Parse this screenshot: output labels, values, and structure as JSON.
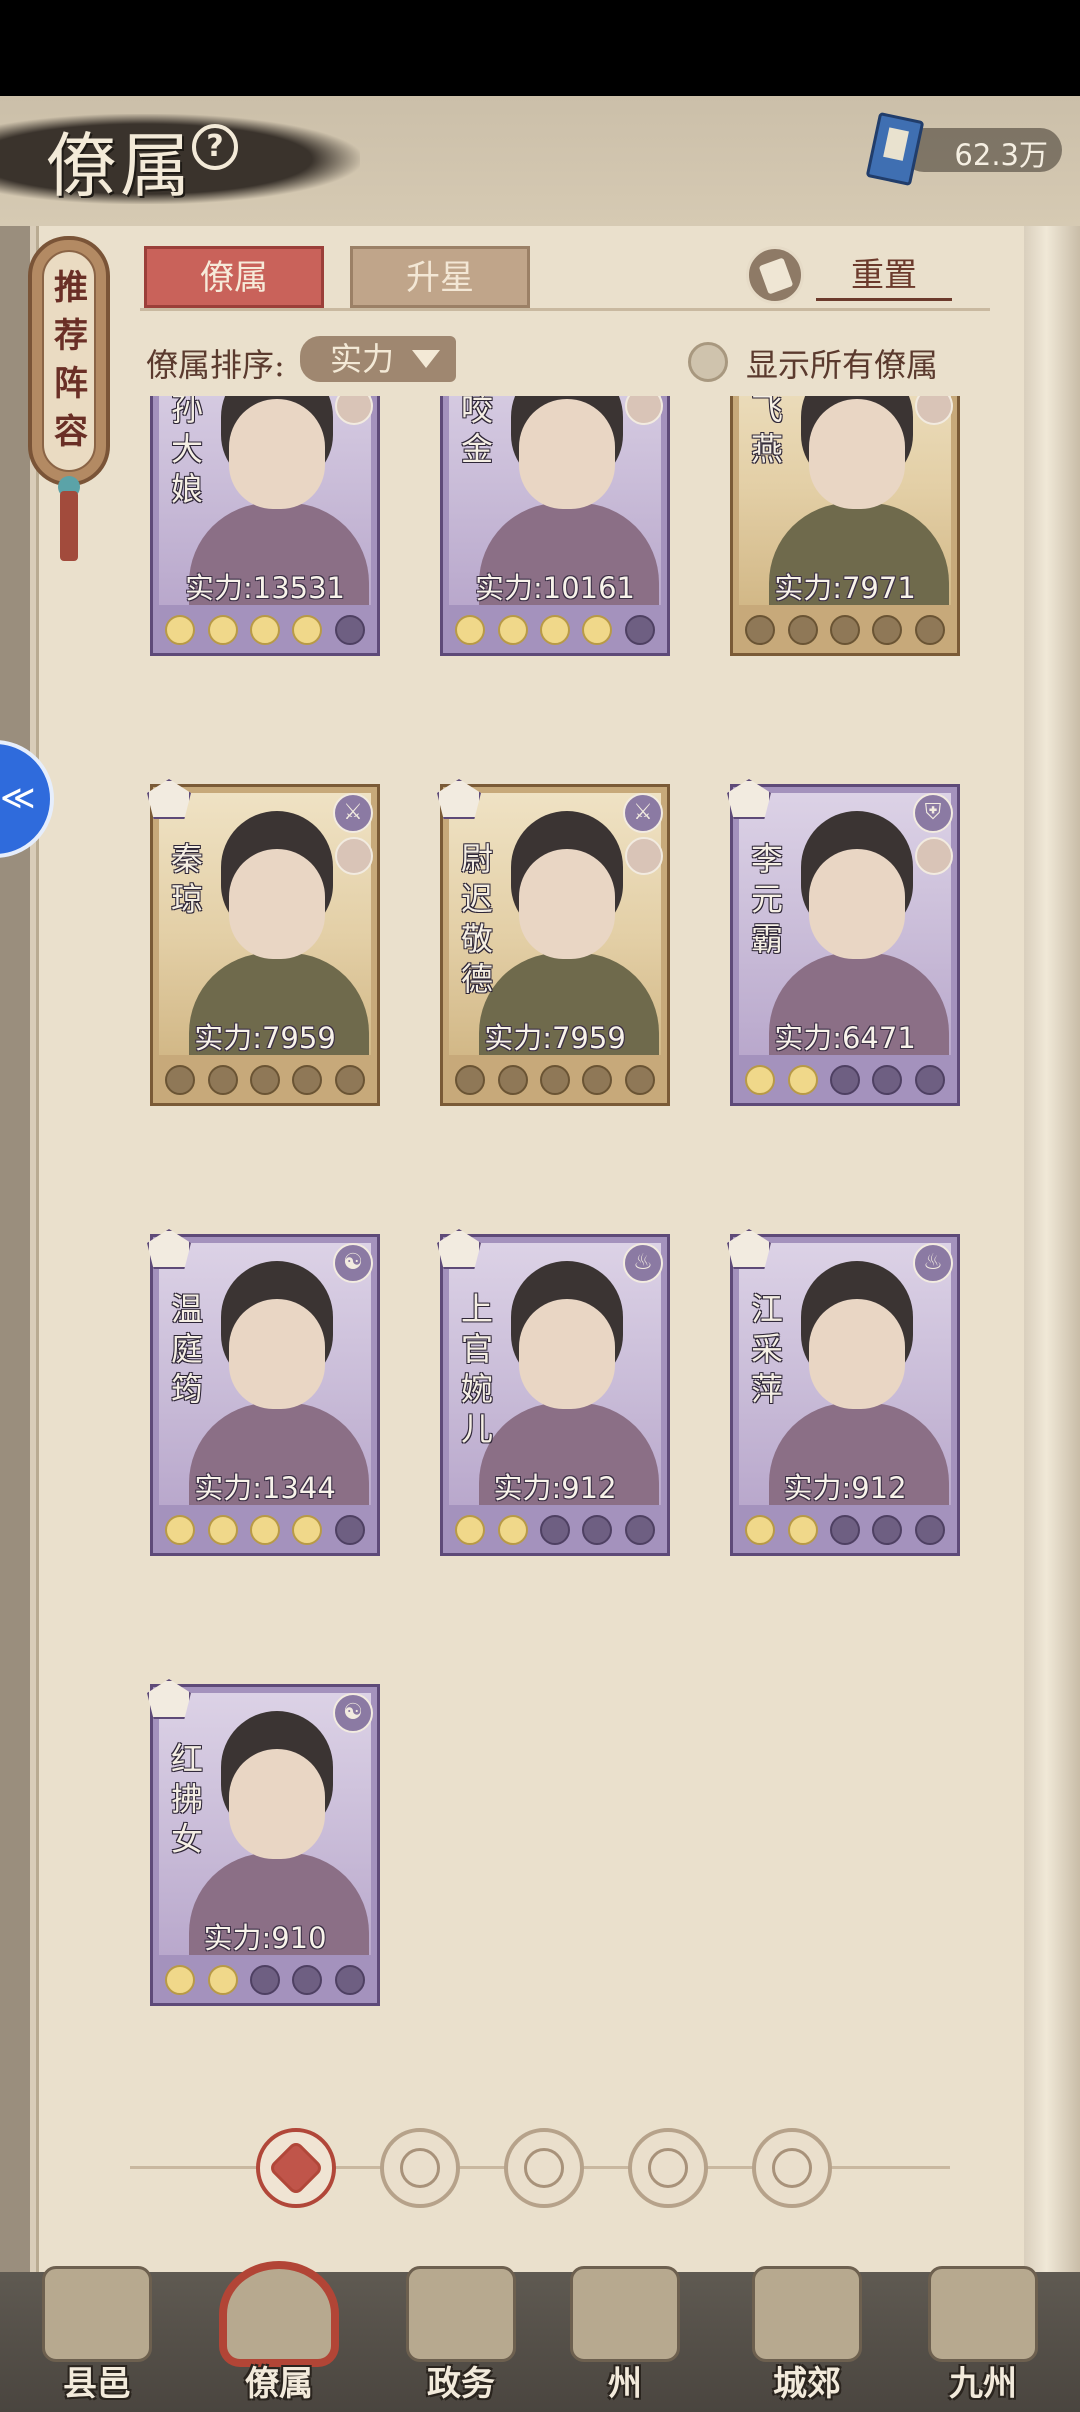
{
  "header": {
    "title": "僚属",
    "currency_value": "62.3万"
  },
  "side": {
    "recommend_label": "推荐阵容"
  },
  "tabs": [
    {
      "label": "僚属",
      "active": true
    },
    {
      "label": "升星",
      "active": false
    }
  ],
  "reset_label": "重置",
  "sort": {
    "label": "僚属排序:",
    "value": "实力"
  },
  "show_all_label": "显示所有僚属",
  "cards": [
    {
      "name": "公孙大娘",
      "power": "实力:13531",
      "stars": 4,
      "frame": "purple"
    },
    {
      "name": "程咬金",
      "power": "实力:10161",
      "stars": 4,
      "frame": "purple"
    },
    {
      "name": "赵飞燕",
      "power": "实力:7971",
      "stars": 2,
      "frame": "gold"
    },
    {
      "name": "秦琼",
      "power": "实力:7959",
      "stars": 2,
      "frame": "gold"
    },
    {
      "name": "尉迟敬德",
      "power": "实力:7959",
      "stars": 2,
      "frame": "gold"
    },
    {
      "name": "李元霸",
      "power": "实力:6471",
      "stars": 2,
      "frame": "purple"
    },
    {
      "name": "温庭筠",
      "power": "实力:1344",
      "stars": 4,
      "frame": "purple"
    },
    {
      "name": "上官婉儿",
      "power": "实力:912",
      "stars": 2,
      "frame": "purple"
    },
    {
      "name": "江采萍",
      "power": "实力:912",
      "stars": 2,
      "frame": "purple"
    },
    {
      "name": "红拂女",
      "power": "实力:910",
      "stars": 2,
      "frame": "purple"
    }
  ],
  "nav": [
    {
      "label": "县邑",
      "active": false
    },
    {
      "label": "僚属",
      "active": true
    },
    {
      "label": "政务",
      "active": false
    },
    {
      "label": "州",
      "active": false
    },
    {
      "label": "城郊",
      "active": false
    },
    {
      "label": "九州",
      "active": false
    }
  ],
  "colors": {
    "tab_active": "#c9625a",
    "paper": "#eae0cc",
    "frame_purple": "#a492bd",
    "frame_gold": "#c7a97a"
  }
}
